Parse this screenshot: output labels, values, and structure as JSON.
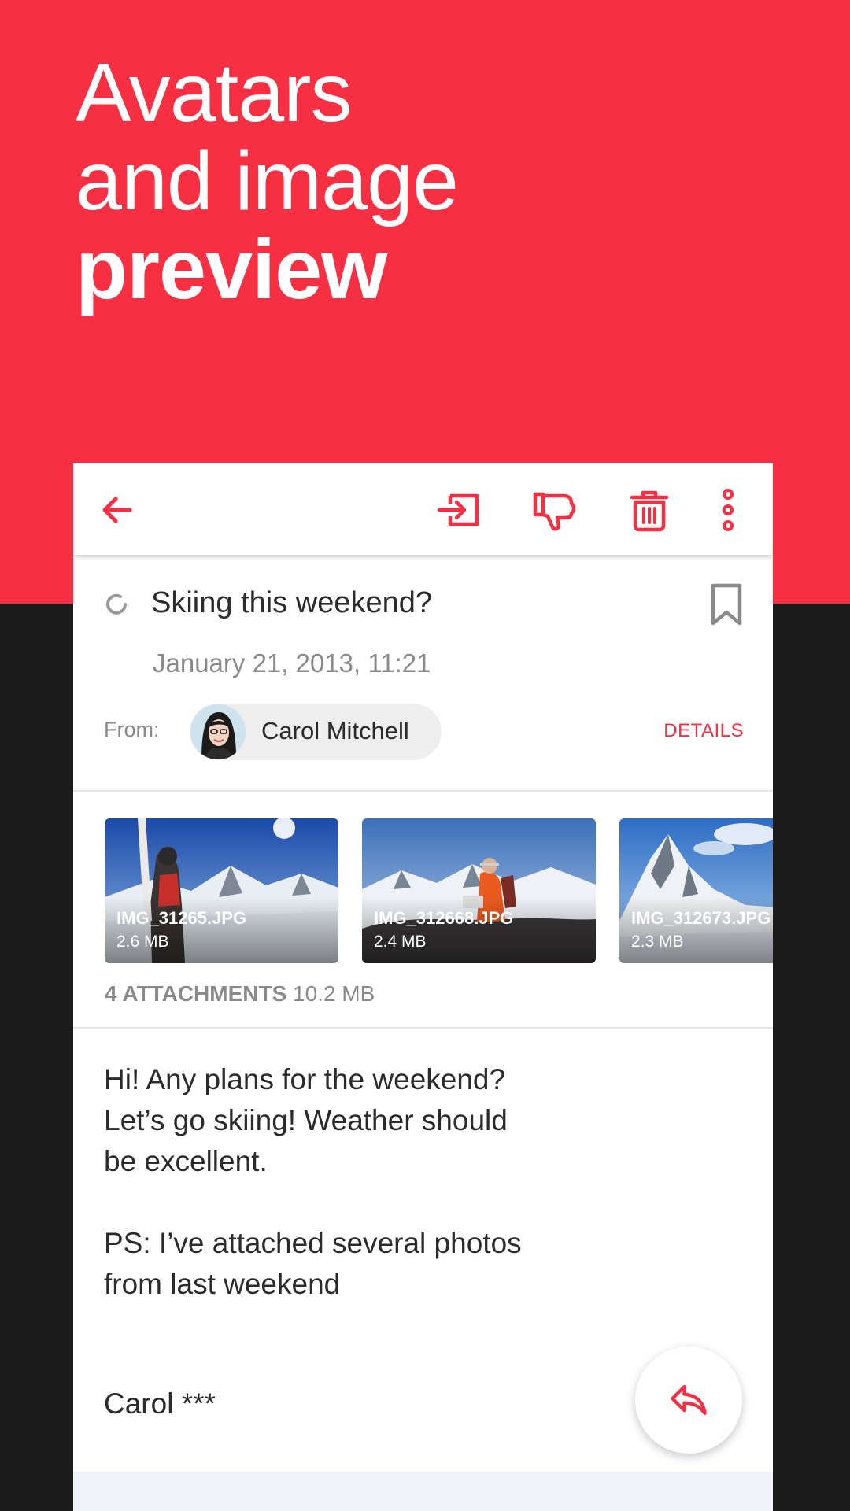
{
  "promo": {
    "line1": "Avatars",
    "line2": "and image",
    "line3": "preview"
  },
  "colors": {
    "accent": "#f72f43",
    "dark_background": "#1c1c1d",
    "text_primary": "#2b2b2b",
    "text_secondary": "#8a8a8a"
  },
  "toolbar": {
    "back_icon": "arrow-left-icon",
    "actions": [
      "move-to-folder-icon",
      "thumbs-down-icon",
      "trash-icon",
      "more-vertical-icon"
    ]
  },
  "message": {
    "subject": "Skiing this weekend?",
    "date": "January 21, 2013, 11:21",
    "from_label": "From:",
    "sender_name": "Carol Mitchell",
    "details_label": "DETAILS",
    "body": "Hi! Any plans for the weekend?\nLet’s go skiing! Weather should\nbe excellent.\n\nPS: I’ve attached several photos\nfrom last weekend",
    "signature": "Carol ***"
  },
  "attachments": {
    "items": [
      {
        "name": "IMG_31265.JPG",
        "size": "2.6 MB"
      },
      {
        "name": "IMG_312668.JPG",
        "size": "2.4 MB"
      },
      {
        "name": "IMG_312673.JPG",
        "size": "2.3 MB"
      }
    ],
    "count_label": "4 ATTACHMENTS",
    "total_size": "10.2 MB"
  },
  "fab": {
    "icon": "reply-icon"
  }
}
